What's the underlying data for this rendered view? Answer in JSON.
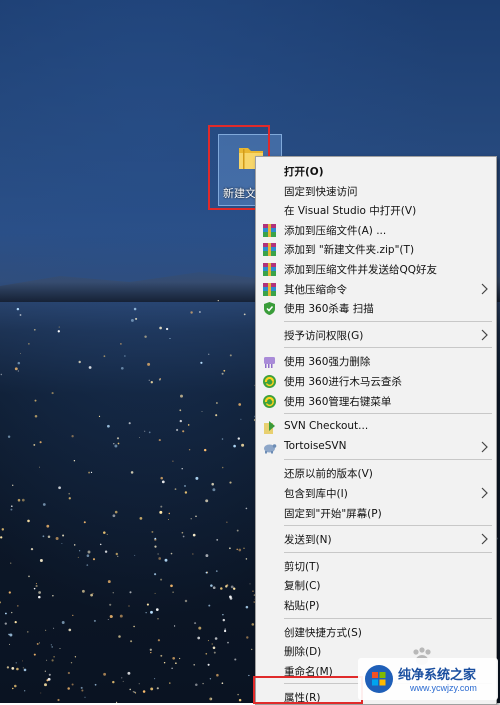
{
  "desktop": {
    "folder_label": "新建文件夹",
    "folder_icon": "folder-icon"
  },
  "context_menu": {
    "items": [
      {
        "label": "打开(O)",
        "icon": "",
        "submenu": false,
        "bold": true
      },
      {
        "label": "固定到快速访问",
        "icon": "",
        "submenu": false
      },
      {
        "label": "在 Visual Studio 中打开(V)",
        "icon": "",
        "submenu": false
      },
      {
        "label": "添加到压缩文件(A) ...",
        "icon": "winrar-icon",
        "submenu": false
      },
      {
        "label": "添加到 \"新建文件夹.zip\"(T)",
        "icon": "winrar-icon",
        "submenu": false
      },
      {
        "label": "添加到压缩文件并发送给QQ好友",
        "icon": "winrar-icon",
        "submenu": false
      },
      {
        "label": "其他压缩命令",
        "icon": "winrar-icon",
        "submenu": true
      },
      {
        "label": "使用 360杀毒 扫描",
        "icon": "360-antivirus-shield-icon",
        "submenu": false
      },
      {
        "label": "授予访问权限(G)",
        "icon": "",
        "submenu": true
      },
      {
        "label": "使用 360强力删除",
        "icon": "360-shredder-icon",
        "submenu": false
      },
      {
        "label": "使用 360进行木马云查杀",
        "icon": "360-security-icon",
        "submenu": false
      },
      {
        "label": "使用 360管理右键菜单",
        "icon": "360-security-icon",
        "submenu": false
      },
      {
        "label": "SVN Checkout...",
        "icon": "svn-checkout-icon",
        "submenu": false
      },
      {
        "label": "TortoiseSVN",
        "icon": "tortoisesvn-icon",
        "submenu": true
      },
      {
        "label": "还原以前的版本(V)",
        "icon": "",
        "submenu": false
      },
      {
        "label": "包含到库中(I)",
        "icon": "",
        "submenu": true
      },
      {
        "label": "固定到\"开始\"屏幕(P)",
        "icon": "",
        "submenu": false
      },
      {
        "label": "发送到(N)",
        "icon": "",
        "submenu": true
      },
      {
        "label": "剪切(T)",
        "icon": "",
        "submenu": false
      },
      {
        "label": "复制(C)",
        "icon": "",
        "submenu": false
      },
      {
        "label": "粘贴(P)",
        "icon": "",
        "submenu": false
      },
      {
        "label": "创建快捷方式(S)",
        "icon": "",
        "submenu": false
      },
      {
        "label": "删除(D)",
        "icon": "",
        "submenu": false
      },
      {
        "label": "重命名(M)",
        "icon": "",
        "submenu": false
      },
      {
        "label": "属性(R)",
        "icon": "",
        "submenu": false
      }
    ]
  },
  "watermark": {
    "title": "纯净系统之家",
    "url": "www.ycwjzy.com"
  },
  "colors": {
    "highlight_box": "#e02a2a",
    "menu_background": "#f2f2f2"
  }
}
